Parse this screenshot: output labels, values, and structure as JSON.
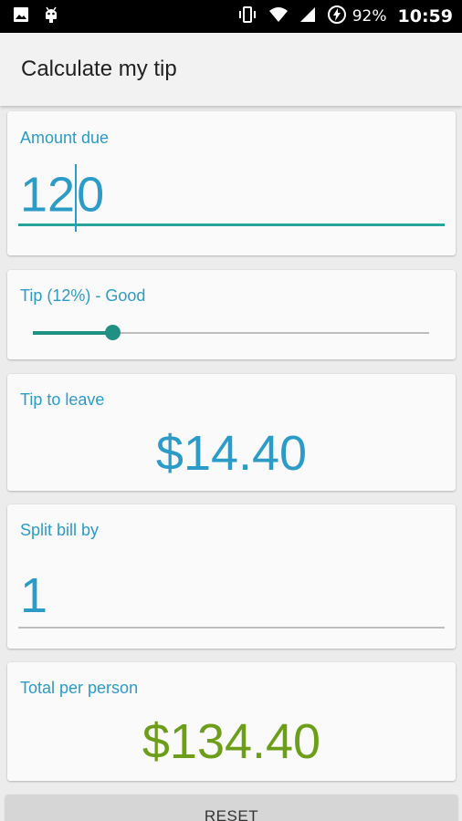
{
  "status_bar": {
    "left_icons": [
      "image-icon",
      "android-debug-icon"
    ],
    "right_icons": [
      "vibrate-icon",
      "wifi-icon",
      "signal-icon",
      "battery-saver-icon"
    ],
    "battery": "92%",
    "time": "10:59"
  },
  "app_bar": {
    "title": "Calculate my tip"
  },
  "amount_due": {
    "label": "Amount due",
    "value": "120"
  },
  "tip": {
    "label": "Tip (12%) - Good",
    "slider_fraction": 0.2,
    "accent": "#1f9183"
  },
  "tip_to_leave": {
    "label": "Tip to leave",
    "value": "$14.40"
  },
  "split": {
    "label": "Split bill by",
    "value": "1"
  },
  "total_per_person": {
    "label": "Total per person",
    "value": "$134.40"
  },
  "reset": {
    "label": "RESET"
  },
  "colors": {
    "label": "#2b9bc7",
    "total": "#6c9e1a",
    "underline_active": "#26a69a"
  }
}
